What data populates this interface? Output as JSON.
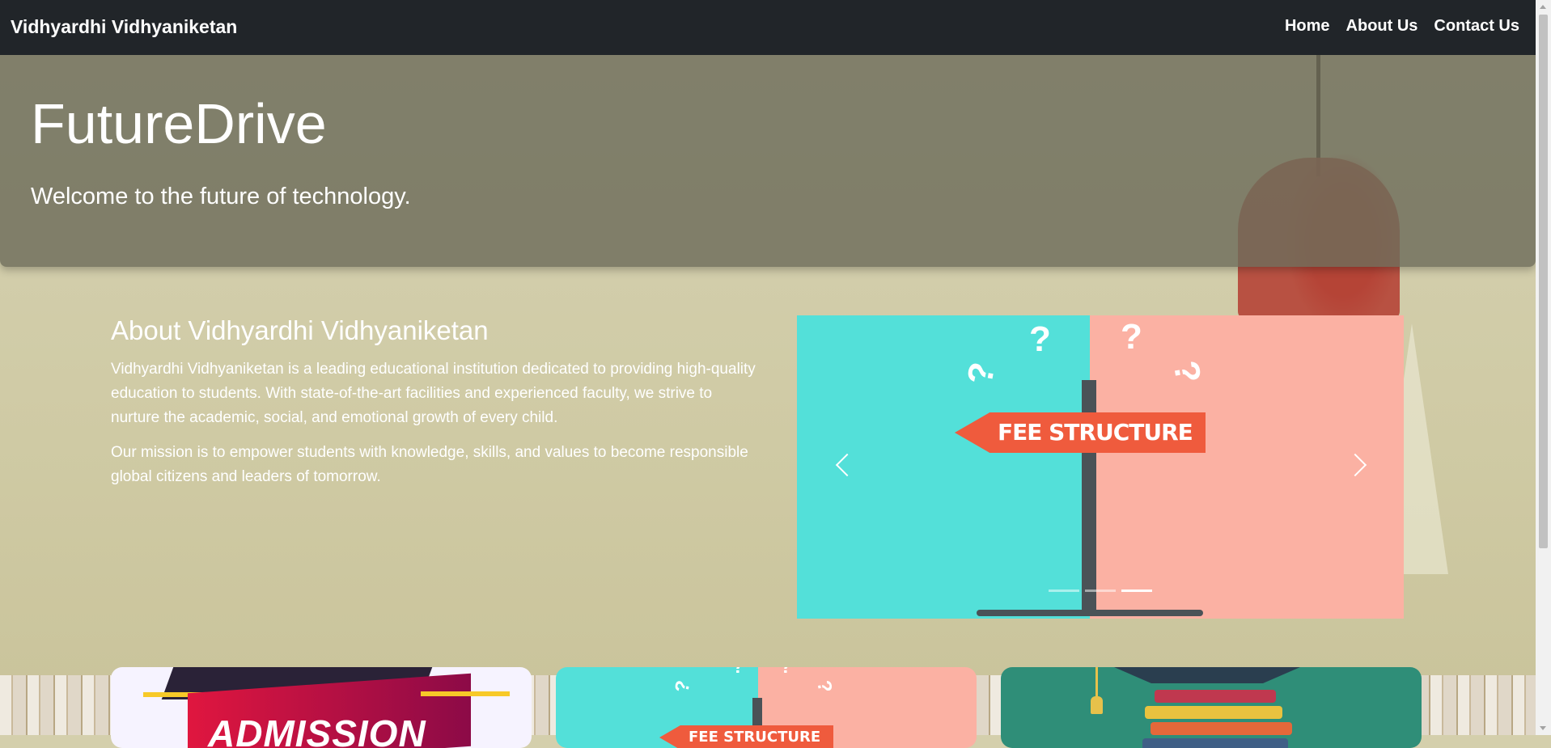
{
  "navbar": {
    "brand": "Vidhyardhi Vidhyaniketan",
    "links": [
      "Home",
      "About Us",
      "Contact Us"
    ]
  },
  "hero": {
    "title": "FutureDrive",
    "subtitle": "Welcome to the future of technology."
  },
  "about": {
    "heading": "About Vidhyardhi Vidhyaniketan",
    "paragraph1": "Vidhyardhi Vidhyaniketan is a leading educational institution dedicated to providing high-quality education to students. With state-of-the-art facilities and experienced faculty, we strive to nurture the academic, social, and emotional growth of every child.",
    "paragraph2": "Our mission is to empower students with knowledge, skills, and values to become responsible global citizens and leaders of tomorrow."
  },
  "carousel": {
    "slide_text": "FEE STRUCTURE",
    "slide_count": 3,
    "active_slide": 3,
    "prev_icon": "chevron-left-icon",
    "next_icon": "chevron-right-icon"
  },
  "cards": [
    {
      "image_text": "ADMISSION"
    },
    {
      "image_text": "FEE STRUCTURE"
    },
    {
      "image_text": ""
    }
  ],
  "colors": {
    "navbar": "#212529",
    "slide_left": "#53e0d9",
    "slide_right": "#fbb1a3",
    "sign": "#ef5b3d"
  }
}
